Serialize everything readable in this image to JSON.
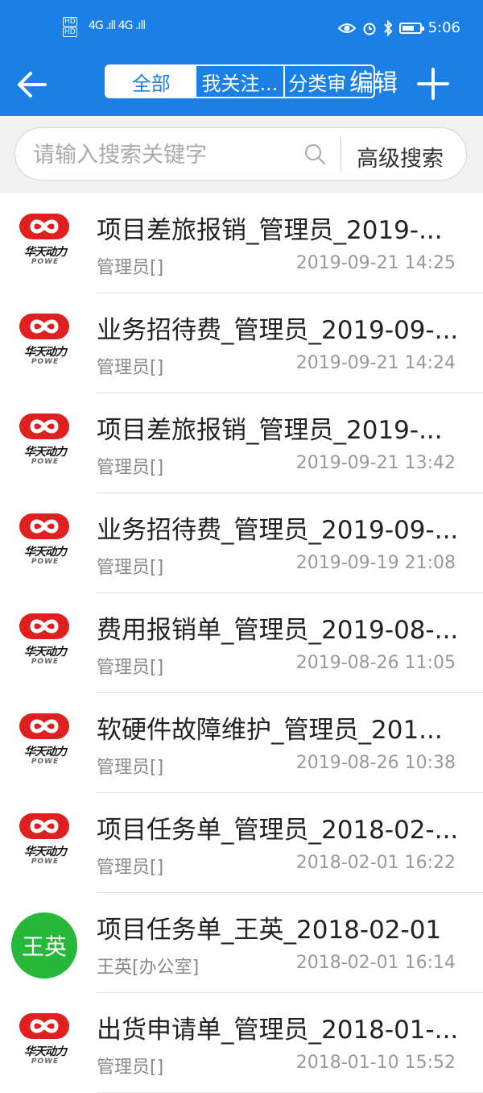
{
  "status_bar": {
    "hd_top": "HD",
    "hd_bottom": "HD",
    "signal": "4G .ıll 4G .ıll",
    "time": "5:06"
  },
  "app_bar": {
    "tabs": [
      {
        "label": "全部",
        "active": true
      },
      {
        "label": "我关注...",
        "active": false
      },
      {
        "label": "分类审",
        "active": false
      }
    ],
    "edit_label": "编辑"
  },
  "search": {
    "placeholder": "请输入搜索关键字",
    "advanced_label": "高级搜索"
  },
  "brand": {
    "name": "华天动力",
    "sub": "POWE",
    "logo_color": "#e02020",
    "accent": "#1a80e6"
  },
  "list": [
    {
      "title": "项目差旅报销_管理员_2019-...",
      "sender": "管理员[]",
      "time": "2019-09-21 14:25"
    },
    {
      "title": "业务招待费_管理员_2019-09-...",
      "sender": "管理员[]",
      "time": "2019-09-21 14:24"
    },
    {
      "title": "项目差旅报销_管理员_2019-...",
      "sender": "管理员[]",
      "time": "2019-09-21 13:42"
    },
    {
      "title": "业务招待费_管理员_2019-09-...",
      "sender": "管理员[]",
      "time": "2019-09-19 21:08"
    },
    {
      "title": "费用报销单_管理员_2019-08-...",
      "sender": "管理员[]",
      "time": "2019-08-26 11:05"
    },
    {
      "title": "软硬件故障维护_管理员_201...",
      "sender": "管理员[]",
      "time": "2019-08-26 10:38"
    },
    {
      "title": "项目任务单_管理员_2018-02-...",
      "sender": "管理员[]",
      "time": "2018-02-01 16:22"
    },
    {
      "title": "项目任务单_王英_2018-02-01",
      "sender": "王英[办公室]",
      "time": "2018-02-01 16:14",
      "avatar_text": "王英",
      "avatar_color": "#27b83a"
    },
    {
      "title": "出货申请单_管理员_2018-01-...",
      "sender": "管理员[]",
      "time": "2018-01-10 15:52"
    }
  ]
}
